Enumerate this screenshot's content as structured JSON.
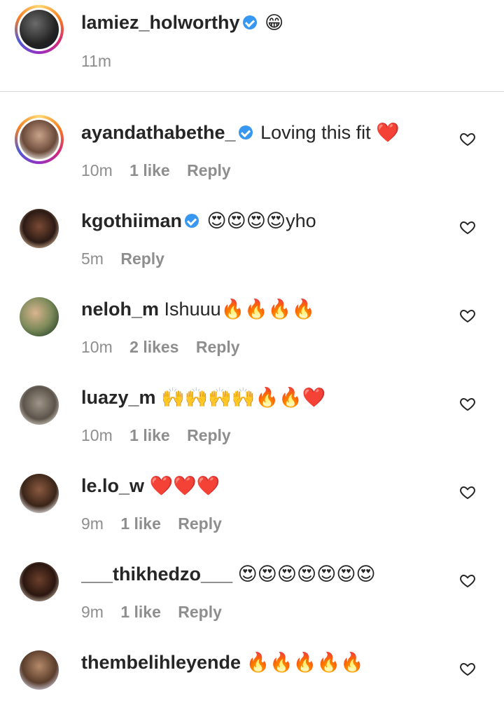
{
  "caption": {
    "username": "lamiez_holworthy",
    "verified": true,
    "text": "😁",
    "time": "11m"
  },
  "comments": [
    {
      "username": "ayandathabethe_",
      "verified": true,
      "text": "Loving this fit ❤️",
      "time": "10m",
      "likes": "1 like",
      "reply": "Reply",
      "story_ring": true
    },
    {
      "username": "kgothiiman",
      "verified": true,
      "text": "😍😍😍😍yho",
      "time": "5m",
      "likes": "",
      "reply": "Reply",
      "story_ring": false
    },
    {
      "username": "neloh_m",
      "verified": false,
      "text": "Ishuuu🔥🔥🔥🔥",
      "time": "10m",
      "likes": "2 likes",
      "reply": "Reply",
      "story_ring": false
    },
    {
      "username": "luazy_m",
      "verified": false,
      "text": "🙌🙌🙌🙌🔥🔥❤️",
      "time": "10m",
      "likes": "1 like",
      "reply": "Reply",
      "story_ring": false
    },
    {
      "username": "le.lo_w",
      "verified": false,
      "text": "❤️❤️❤️",
      "time": "9m",
      "likes": "1 like",
      "reply": "Reply",
      "story_ring": false
    },
    {
      "username": "___thikhedzo___",
      "verified": false,
      "text": "😍😍😍😍😍😍😍",
      "time": "9m",
      "likes": "1 like",
      "reply": "Reply",
      "story_ring": false
    },
    {
      "username": "thembelihleyende",
      "verified": false,
      "text": "🔥🔥🔥🔥🔥",
      "time": "",
      "likes": "",
      "reply": "",
      "story_ring": false
    }
  ],
  "icons": {
    "verified": "verified-badge-icon",
    "like": "heart-outline-icon"
  },
  "colors": {
    "username": "#262626",
    "meta": "#8e8e8e",
    "verified": "#3897f0",
    "divider": "#dbdbdb"
  }
}
